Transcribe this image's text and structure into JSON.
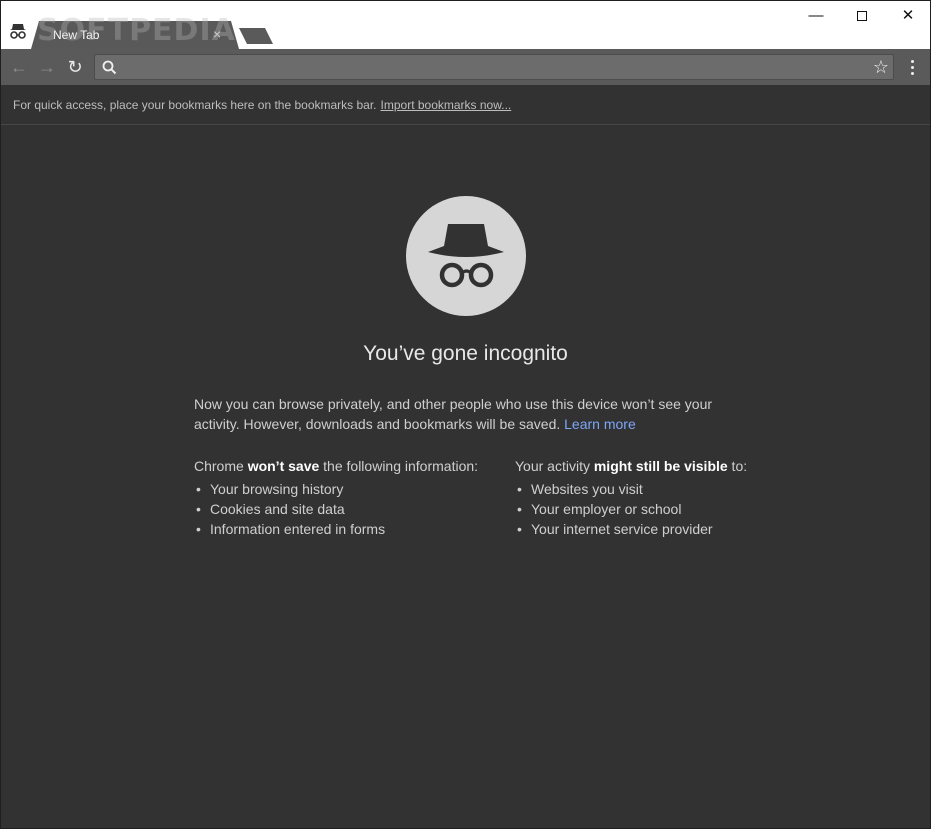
{
  "tab": {
    "title": "New Tab",
    "close_glyph": "×"
  },
  "watermark": "SOFTPEDIA",
  "window_controls": {
    "minimize": "—",
    "close": "✕"
  },
  "toolbar": {
    "back_glyph": "←",
    "forward_glyph": "→",
    "reload_glyph": "↻",
    "star_glyph": "☆",
    "omnibox_value": ""
  },
  "bookmarks_bar": {
    "text": "For quick access, place your bookmarks here on the bookmarks bar.",
    "link": "Import bookmarks now..."
  },
  "page": {
    "headline": "You’ve gone incognito",
    "description": "Now you can browse privately, and other people who use this device won’t see your activity. However, downloads and bookmarks will be saved.",
    "learn_more": "Learn more",
    "wont_save": {
      "prefix": "Chrome ",
      "bold": "won’t save",
      "suffix": " the following information:",
      "items": [
        "Your browsing history",
        "Cookies and site data",
        "Information entered in forms"
      ]
    },
    "might_be_visible": {
      "prefix": "Your activity ",
      "bold": "might still be visible",
      "suffix": " to:",
      "items": [
        "Websites you visit",
        "Your employer or school",
        "Your internet service provider"
      ]
    }
  },
  "icons": {
    "tab_icon": "incognito-icon",
    "hero": "incognito-icon",
    "search": "search-icon",
    "star": "star-icon",
    "menu": "more-vert-icon"
  },
  "colors": {
    "background": "#323232",
    "toolbar": "#5a5a5a",
    "link": "#7ea6f7",
    "hero_circle": "#d6d6d6"
  }
}
